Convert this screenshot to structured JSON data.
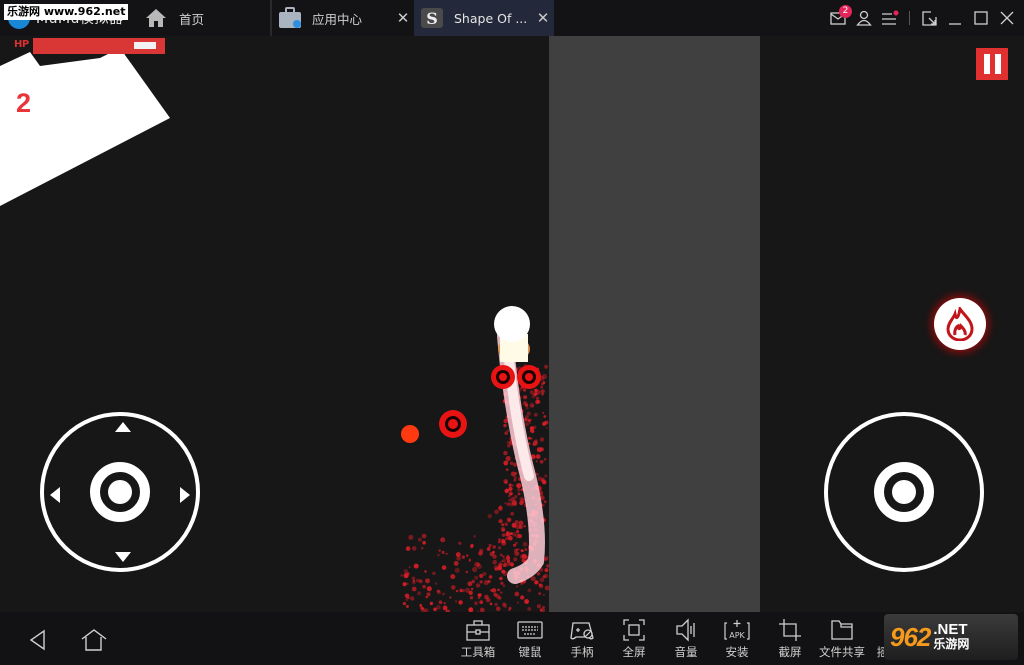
{
  "titlebar": {
    "app_name": "MuMu模拟器",
    "watermark": "乐游网 www.962.net",
    "tabs": [
      {
        "label": "首页",
        "icon": "home-icon"
      },
      {
        "label": "应用中心",
        "icon": "app-center-icon",
        "closable": true
      },
      {
        "label": "Shape Of ...",
        "icon": "game-s-icon",
        "closable": true,
        "active": true
      }
    ],
    "close_glyph": "✕",
    "mail_badge": "2",
    "controls": [
      "mail-icon",
      "user-icon",
      "menu-icon",
      "resize-icon",
      "minimize-icon",
      "maximize-icon",
      "close-icon"
    ]
  },
  "game": {
    "hp_label": "HP",
    "hp_fraction": 0.8,
    "score": "2",
    "pause_icon": "pause-icon",
    "fire_icon": "flame-icon",
    "colors": {
      "accent_red": "#e0302f",
      "background": "#171717",
      "wall": "#404040"
    }
  },
  "bottombar": {
    "nav": [
      {
        "name": "back",
        "icon": "back-triangle-icon"
      },
      {
        "name": "home",
        "icon": "home-outline-icon"
      }
    ],
    "tools": [
      {
        "label": "工具箱",
        "icon": "toolbox-icon"
      },
      {
        "label": "键鼠",
        "icon": "keyboard-icon"
      },
      {
        "label": "手柄",
        "icon": "gamepad-icon"
      },
      {
        "label": "全屏",
        "icon": "fullscreen-icon"
      },
      {
        "label": "音量",
        "icon": "volume-icon"
      },
      {
        "label": "安装",
        "icon": "apk-install-icon"
      },
      {
        "label": "截屏",
        "icon": "crop-icon"
      },
      {
        "label": "文件共享",
        "icon": "folder-icon"
      },
      {
        "label": "摇一摇",
        "icon": "shake-icon"
      }
    ],
    "watermark": {
      "number": "962",
      "domain": ".NET",
      "cn": "乐游网"
    }
  }
}
